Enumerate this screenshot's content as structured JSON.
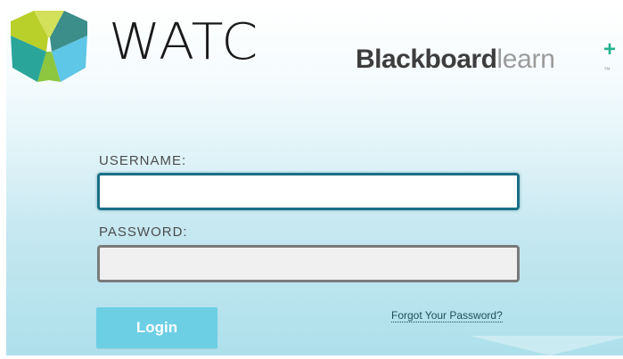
{
  "header": {
    "brand_name": "WATC",
    "partner_brand": {
      "strong": "Blackboard",
      "light": "learn",
      "plus": "+",
      "trademark": "™"
    },
    "logo_icon": "watc-shield-logo"
  },
  "login_form": {
    "username_label": "USERNAME:",
    "username_value": "",
    "password_label": "PASSWORD:",
    "password_value": "",
    "login_button_label": "Login",
    "forgot_password_link": "Forgot Your Password?"
  },
  "colors": {
    "accent": "#6ccfe4",
    "username_border": "#1b6f87",
    "password_border": "#7a7a7a",
    "logo_green": "#b9cf2a",
    "logo_teal": "#2aa59a",
    "logo_blue": "#5ec6e6",
    "blackboard_plus": "#24b28f"
  }
}
